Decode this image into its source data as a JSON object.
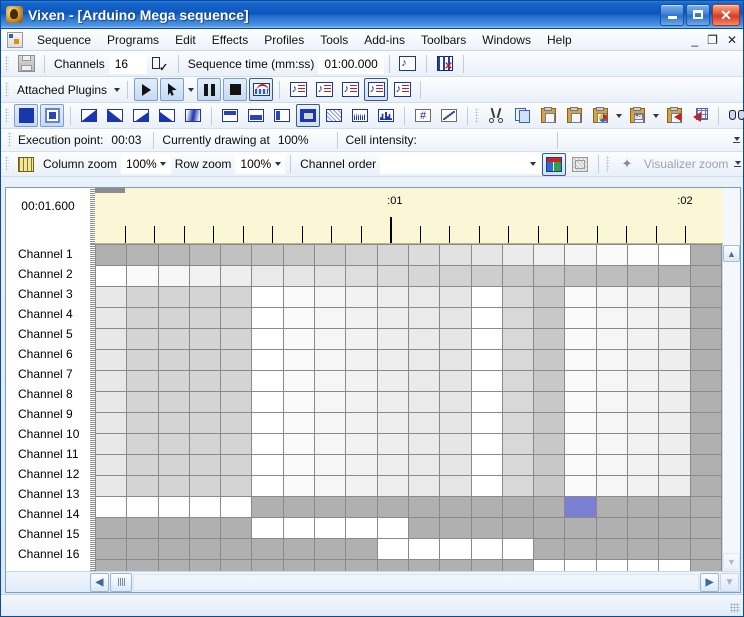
{
  "window": {
    "title": "Vixen - [Arduino Mega sequence]",
    "app_icon": "vixen-icon",
    "buttons": {
      "minimize": "_",
      "maximize": "□",
      "close": "✕"
    }
  },
  "menu": {
    "mdi_icon": "mdi-window-icon",
    "items": [
      "Sequence",
      "Programs",
      "Edit",
      "Effects",
      "Profiles",
      "Tools",
      "Add-ins",
      "Toolbars",
      "Windows",
      "Help"
    ],
    "mdi_buttons": {
      "minimize": "_",
      "restore": "❐",
      "close": "✕"
    }
  },
  "toolbar_main": {
    "save_icon": "save-icon",
    "channels_label": "Channels",
    "channels_value": "16",
    "channel_config_icon": "channel-checklist-icon",
    "sequence_time_label": "Sequence time (mm:ss)",
    "sequence_time_value": "01:00.000",
    "audio_icon": "music-note-icon",
    "remove_audio_icon": "remove-audio-icon"
  },
  "toolbar_plugins": {
    "attached_plugins_label": "Attached Plugins",
    "play_icon": "play-icon",
    "play_point_icon": "play-from-point-icon",
    "pause_icon": "pause-icon",
    "stop_icon": "stop-icon",
    "waveform_icon": "audio-waveform-icon",
    "note_icons": [
      "note-toolbar-1-icon",
      "note-toolbar-2-icon",
      "note-toolbar-3-icon",
      "note-toolbar-4-icon",
      "note-toolbar-5-icon"
    ],
    "selected_indices": [
      4,
      7
    ]
  },
  "toolbar_draw": {
    "icons": [
      "solid-fill-icon",
      "outline-fill-icon",
      "ramp-up-icon",
      "ramp-down-icon",
      "ramp-up-partial-icon",
      "ramp-down-partial-icon",
      "gradient-icon",
      "fill-top-icon",
      "fill-bottom-icon",
      "fill-left-icon",
      "fill-solid-icon",
      "random-icon",
      "sparkle-icon",
      "ramp-bars-icon",
      "sequence-number-icon",
      "diagonal-line-icon"
    ],
    "selected_indices": [
      0,
      10
    ]
  },
  "toolbar_edit": {
    "icons": [
      "cut-icon",
      "copy-icon",
      "paste-icon",
      "paste-special-icon",
      "paste-color-icon",
      "paste-value-icon",
      "paste-insert-icon",
      "insert-grid-icon",
      "find-icon",
      "undo-icon",
      "redo-icon"
    ]
  },
  "status_strip": {
    "execution_point_label": "Execution point:",
    "execution_point_value": "00:03",
    "currently_drawing_label": "Currently drawing at",
    "currently_drawing_value": "100%",
    "cell_intensity_label": "Cell intensity:",
    "cell_intensity_value": ""
  },
  "zoom_strip": {
    "grid_icon": "grid-icon",
    "column_zoom_label": "Column zoom",
    "column_zoom_value": "100%",
    "row_zoom_label": "Row zoom",
    "row_zoom_value": "100%",
    "channel_order_label": "Channel order",
    "channel_order_value": "",
    "visualizer_icon": "visualizer-icon",
    "visualizer_off_icon": "visualizer-disabled-icon",
    "sparkline_icon": "sparkline-icon",
    "visualizer_zoom_label": "Visualizer zoom"
  },
  "timeline": {
    "current_time": "00:01.600",
    "tick_labels": [
      {
        "text": ":01",
        "x_pct": 47.0
      },
      {
        "text": ":02",
        "x_pct": 93.2
      }
    ],
    "minor_tick_count": 20,
    "major_tick_pcts": [
      47.0,
      93.2
    ],
    "playhead_width_pct": 4.8
  },
  "grid": {
    "channel_names": [
      "Channel 1",
      "Channel 2",
      "Channel 3",
      "Channel 4",
      "Channel 5",
      "Channel 6",
      "Channel 7",
      "Channel 8",
      "Channel 9",
      "Channel 10",
      "Channel 11",
      "Channel 12",
      "Channel 13",
      "Channel 14",
      "Channel 15",
      "Channel 16"
    ],
    "columns": 20,
    "colors": {
      "white": "#ffffff",
      "selected": "#7b7fd4",
      "cell_border": "#8a8a8a"
    },
    "cell_values": [
      [
        176,
        180,
        184,
        188,
        192,
        196,
        200,
        205,
        210,
        215,
        220,
        225,
        230,
        235,
        240,
        245,
        250,
        252,
        255,
        176
      ],
      [
        255,
        250,
        246,
        242,
        238,
        234,
        230,
        226,
        222,
        218,
        214,
        210,
        206,
        202,
        198,
        194,
        190,
        186,
        182,
        176
      ],
      [
        232,
        212,
        212,
        212,
        212,
        255,
        250,
        246,
        242,
        238,
        234,
        230,
        255,
        216,
        200,
        250,
        246,
        242,
        238,
        176
      ],
      [
        232,
        212,
        212,
        212,
        212,
        255,
        250,
        246,
        242,
        238,
        234,
        230,
        255,
        216,
        200,
        250,
        246,
        242,
        238,
        176
      ],
      [
        232,
        212,
        212,
        212,
        212,
        255,
        250,
        246,
        242,
        238,
        234,
        230,
        255,
        216,
        200,
        250,
        246,
        242,
        238,
        176
      ],
      [
        232,
        212,
        212,
        212,
        212,
        255,
        250,
        246,
        242,
        238,
        234,
        230,
        255,
        216,
        200,
        250,
        246,
        242,
        238,
        176
      ],
      [
        232,
        212,
        212,
        212,
        212,
        255,
        250,
        246,
        242,
        238,
        234,
        230,
        255,
        216,
        200,
        250,
        246,
        242,
        238,
        176
      ],
      [
        232,
        212,
        212,
        212,
        212,
        255,
        250,
        246,
        242,
        238,
        234,
        230,
        255,
        216,
        200,
        250,
        246,
        242,
        238,
        176
      ],
      [
        232,
        212,
        212,
        212,
        212,
        255,
        250,
        246,
        242,
        238,
        234,
        230,
        255,
        216,
        200,
        250,
        246,
        242,
        238,
        176
      ],
      [
        232,
        212,
        212,
        212,
        212,
        255,
        250,
        246,
        242,
        238,
        234,
        230,
        255,
        216,
        200,
        250,
        246,
        242,
        238,
        176
      ],
      [
        232,
        212,
        212,
        212,
        212,
        255,
        250,
        246,
        242,
        238,
        234,
        230,
        255,
        216,
        200,
        250,
        246,
        242,
        238,
        176
      ],
      [
        232,
        212,
        212,
        212,
        212,
        255,
        250,
        246,
        242,
        238,
        234,
        230,
        255,
        216,
        200,
        250,
        246,
        242,
        238,
        176
      ],
      [
        255,
        255,
        255,
        255,
        255,
        176,
        176,
        176,
        176,
        176,
        176,
        176,
        176,
        176,
        176,
        176,
        176,
        176,
        176,
        176
      ],
      [
        176,
        176,
        176,
        176,
        176,
        255,
        255,
        255,
        255,
        255,
        176,
        176,
        176,
        176,
        176,
        176,
        176,
        176,
        176,
        176
      ],
      [
        176,
        176,
        176,
        176,
        176,
        176,
        176,
        176,
        176,
        255,
        255,
        255,
        255,
        255,
        176,
        176,
        176,
        176,
        176,
        176
      ],
      [
        176,
        176,
        176,
        176,
        176,
        176,
        176,
        176,
        176,
        176,
        176,
        176,
        176,
        176,
        255,
        255,
        255,
        255,
        255,
        176
      ]
    ],
    "selected_cell": {
      "row": 12,
      "col": 15
    }
  },
  "scrollbars": {
    "vertical": {
      "up_icon": "scroll-up-icon",
      "down_icon": "scroll-down-icon"
    },
    "horizontal": {
      "left_icon": "scroll-left-icon",
      "right_icon": "scroll-right-icon",
      "thumb_icon": "scroll-thumb-grip"
    }
  }
}
